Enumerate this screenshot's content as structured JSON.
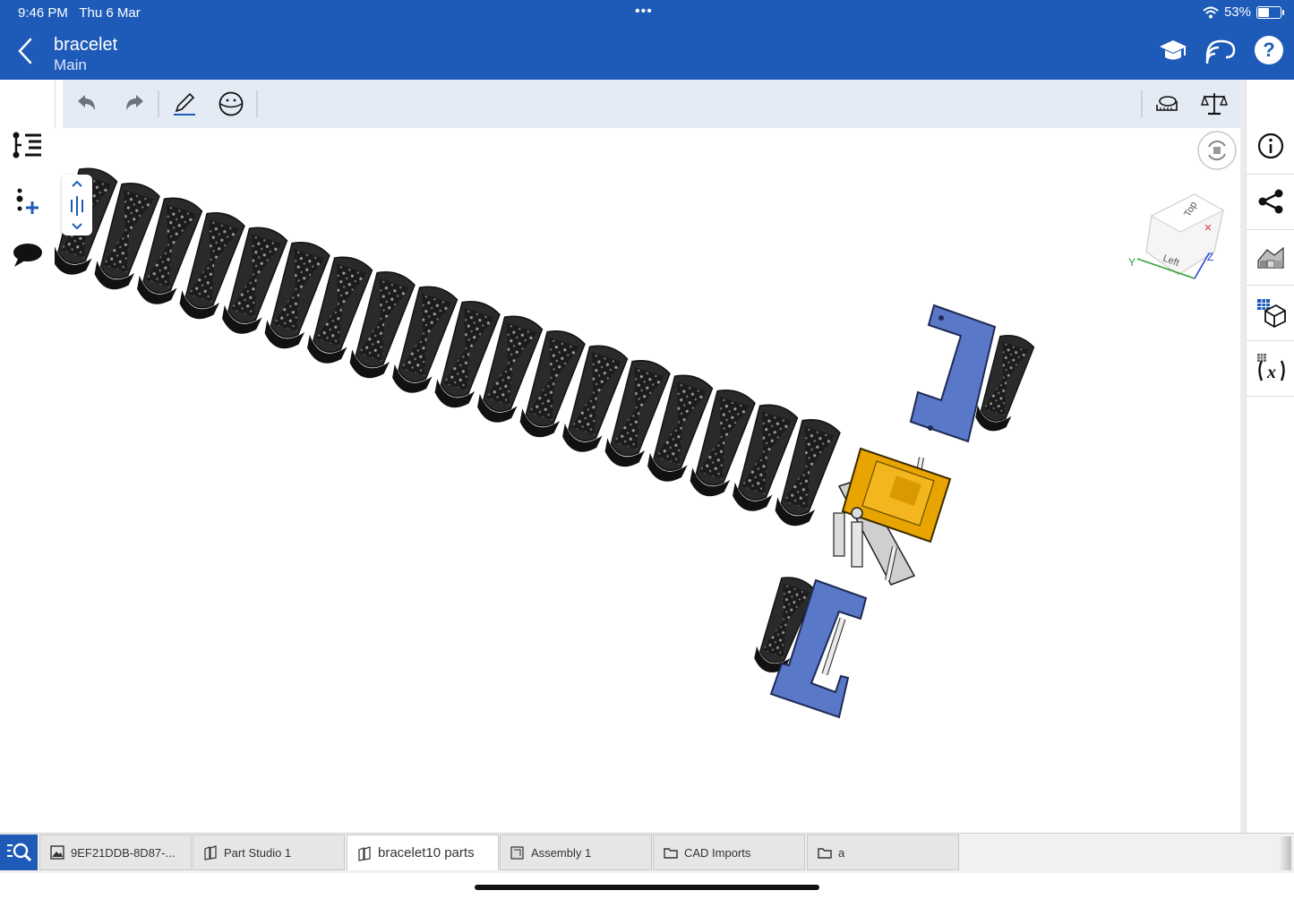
{
  "status_bar": {
    "time": "9:46 PM",
    "date": "Thu 6 Mar",
    "battery": "53%",
    "battery_level": 0.53
  },
  "header": {
    "title": "bracelet",
    "subtitle": "Main"
  },
  "header_icons": [
    "learning-center-icon",
    "connect-icon",
    "help-icon"
  ],
  "left_sidebar": [
    "feature-list-icon",
    "insert-icon",
    "comments-icon"
  ],
  "toolbar_left": [
    "undo-icon",
    "redo-icon",
    "sketch-icon",
    "view-mode-icon"
  ],
  "toolbar_right": [
    "measure-icon",
    "mass-properties-icon"
  ],
  "right_sidebar": [
    "info-icon",
    "share-icon",
    "appearance-icon",
    "bill-of-materials-icon",
    "variables-icon"
  ],
  "view_cube": {
    "top_label": "Top",
    "left_label": "Left",
    "axis_y": "Y",
    "axis_z": "Z"
  },
  "colors": {
    "brand": "#1e5bb8",
    "link_part": "#1f1f1f",
    "clasp_part": "#5a78c8",
    "buckle_part": "#e8a400"
  },
  "tabs": [
    {
      "label": "9EF21DDB-8D87-...",
      "icon": "image-icon"
    },
    {
      "label": "Part Studio 1",
      "icon": "part-studio-icon"
    },
    {
      "label": "bracelet10 parts",
      "icon": "part-studio-icon",
      "active": true
    },
    {
      "label": "Assembly 1",
      "icon": "assembly-icon"
    },
    {
      "label": "CAD Imports",
      "icon": "folder-icon"
    },
    {
      "label": "a",
      "icon": "folder-icon"
    }
  ]
}
